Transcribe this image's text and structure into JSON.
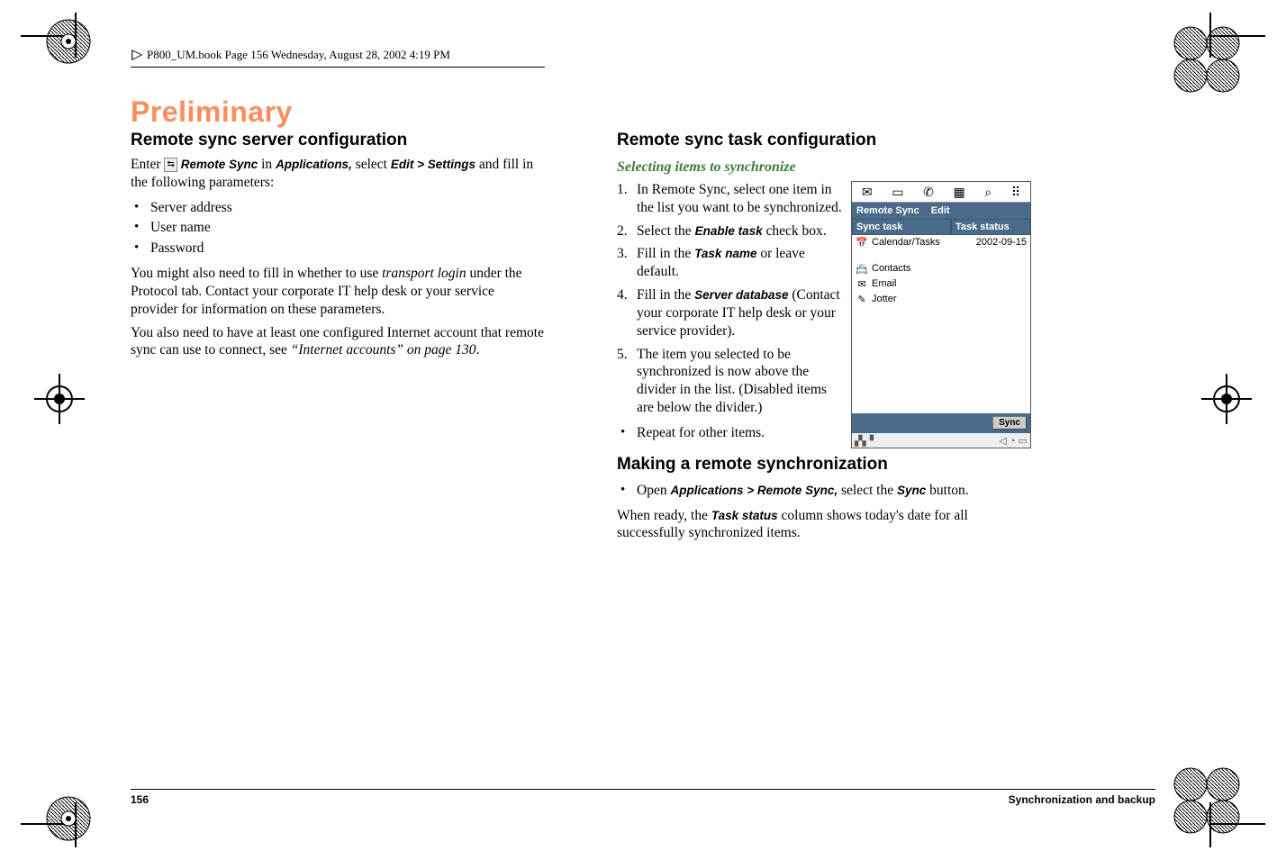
{
  "header": {
    "text": "P800_UM.book  Page 156  Wednesday, August 28, 2002  4:19 PM"
  },
  "watermark": "Preliminary",
  "left": {
    "h2": "Remote sync server configuration",
    "intro_pre": "Enter ",
    "intro_icon_label": "remote-sync-app-icon",
    "intro_rs": "Remote Sync",
    "intro_in": " in ",
    "intro_apps": "Applications,",
    "intro_sel": " select ",
    "intro_edit": "Edit > Settings",
    "intro_post": " and fill in the following parameters:",
    "bullets": [
      "Server address",
      "User name",
      "Password"
    ],
    "p2a": "You might also need to fill in whether to use ",
    "p2_em": "transport login",
    "p2b": " under the Protocol tab. Contact your corporate IT help desk or your service provider for information on these parameters.",
    "p3a": "You also need to have at least one configured Internet account that remote sync can use to connect, see ",
    "p3_em": "“Internet accounts” on page 130",
    "p3b": "."
  },
  "right": {
    "h2": "Remote sync task configuration",
    "sub": "Selecting items to synchronize",
    "steps": [
      {
        "t": "In Remote Sync, select one item in the list you want to be synchronized."
      },
      {
        "pre": "Select the ",
        "b": "Enable task",
        "post": " check box."
      },
      {
        "pre": "Fill in the ",
        "b": "Task name",
        "post": " or leave default."
      },
      {
        "pre": "Fill in the ",
        "b": "Server database",
        "post": " (Contact your corporate IT help desk or your service provider)."
      },
      {
        "t": "The item you selected to be synchronized is now above the divider in the list. (Disabled items are below the divider.)"
      }
    ],
    "repeat": "Repeat for other items.",
    "h2b": "Making a remote synchronization",
    "open_pre": "Open ",
    "open_path": "Applications > Remote Sync,",
    "open_mid": " select the ",
    "open_sync": "Sync",
    "open_post": " button.",
    "when_pre": "When ready, the ",
    "when_b": "Task status",
    "when_post": " column shows today's date for all successfully synchronized items."
  },
  "device": {
    "menu": {
      "app": "Remote Sync",
      "edit": "Edit"
    },
    "th_left": "Sync task",
    "th_right": "Task status",
    "rows_above": [
      {
        "icon": "📅",
        "name": "Calendar/Tasks",
        "status": "2002-09-15"
      }
    ],
    "rows_below": [
      {
        "icon": "📇",
        "name": "Contacts",
        "status": ""
      },
      {
        "icon": "✉",
        "name": "Email",
        "status": ""
      },
      {
        "icon": "✎",
        "name": "Jotter",
        "status": ""
      }
    ],
    "sync_btn": "Sync"
  },
  "footer": {
    "page": "156",
    "section": "Synchronization and backup"
  }
}
